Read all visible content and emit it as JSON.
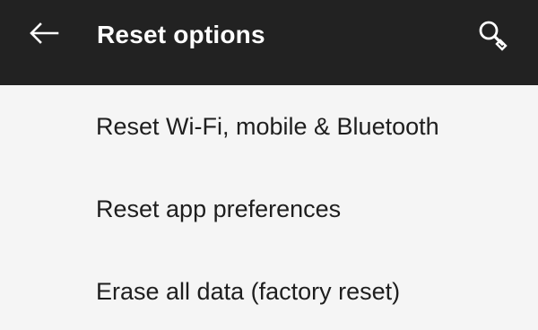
{
  "toolbar": {
    "back_icon": "arrow-left-icon",
    "title": "Reset options",
    "search_icon": "search-icon"
  },
  "options": [
    {
      "label": "Reset Wi-Fi, mobile & Bluetooth"
    },
    {
      "label": "Reset app preferences"
    },
    {
      "label": "Erase all data (factory reset)"
    }
  ],
  "colors": {
    "toolbar_background": "#222222",
    "page_background": "#f5f5f5",
    "toolbar_text": "#ffffff",
    "body_text": "#1e1e1e"
  }
}
